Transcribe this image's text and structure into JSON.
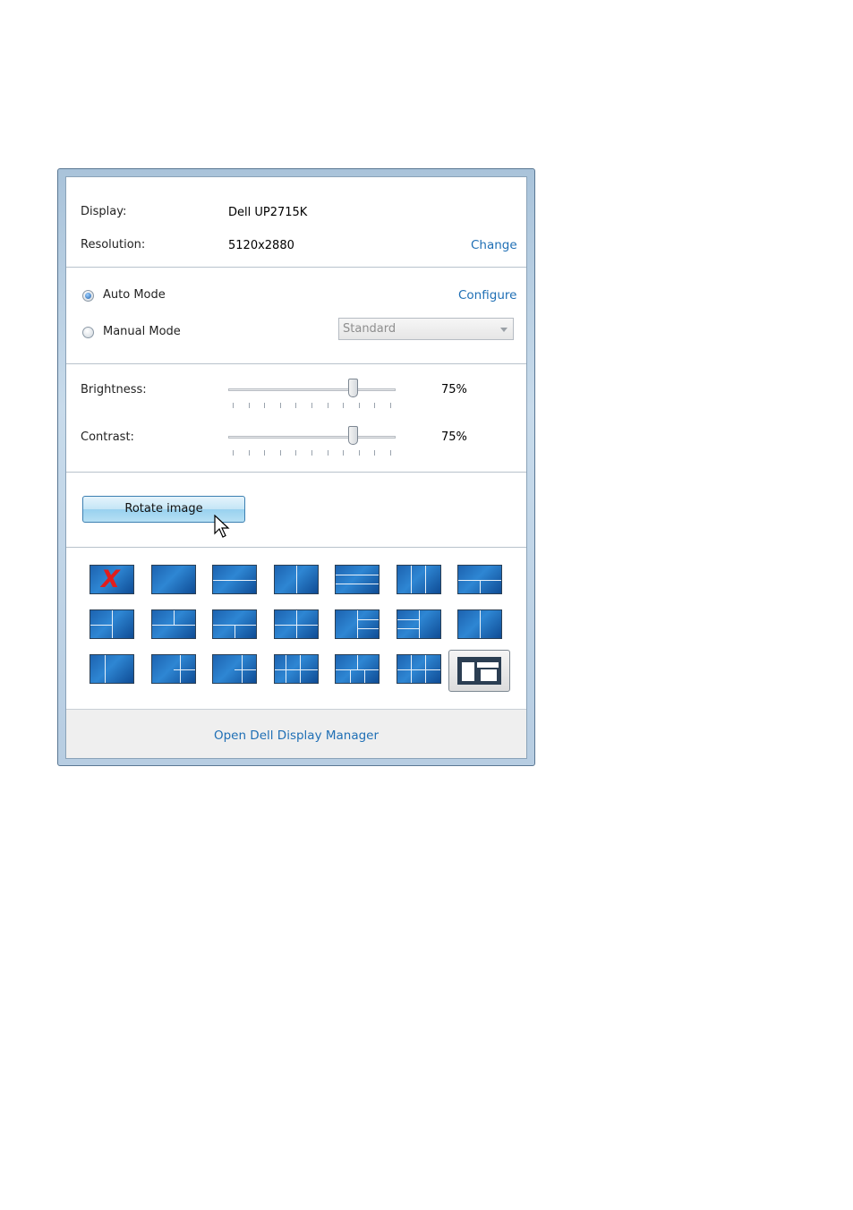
{
  "display": {
    "label": "Display:",
    "value": "Dell UP2715K"
  },
  "resolution": {
    "label": "Resolution:",
    "value": "5120x2880",
    "change_link": "Change"
  },
  "modes": {
    "auto_label": "Auto Mode",
    "manual_label": "Manual Mode",
    "selected": "auto",
    "configure_link": "Configure",
    "manual_preset": "Standard"
  },
  "brightness": {
    "label": "Brightness:",
    "value_text": "75%",
    "level": 0.75
  },
  "contrast": {
    "label": "Contrast:",
    "value_text": "75%",
    "level": 0.75
  },
  "rotate_button": "Rotate image",
  "layout_icons": [
    "layout-none-icon",
    "layout-full-icon",
    "layout-two-horizontal-icon",
    "layout-two-vertical-icon",
    "layout-three-horizontal-icon",
    "layout-three-vertical-icon",
    "layout-top-two-bottom-icon",
    "layout-left-two-right-icon",
    "layout-two-top-one-bottom-icon",
    "layout-one-top-two-bottom-icon",
    "layout-four-mixed-icon",
    "layout-left-three-right-icon",
    "layout-three-left-right-icon",
    "layout-wide-left-icon",
    "layout-wide-left-split-icon",
    "layout-right-split-icon",
    "layout-quad-large-icon",
    "layout-five-icon",
    "layout-five-alt-icon",
    "layout-six-icon",
    "layout-picture-in-picture-icon"
  ],
  "selected_layout": "layout-picture-in-picture-icon",
  "footer_link": "Open Dell Display Manager"
}
